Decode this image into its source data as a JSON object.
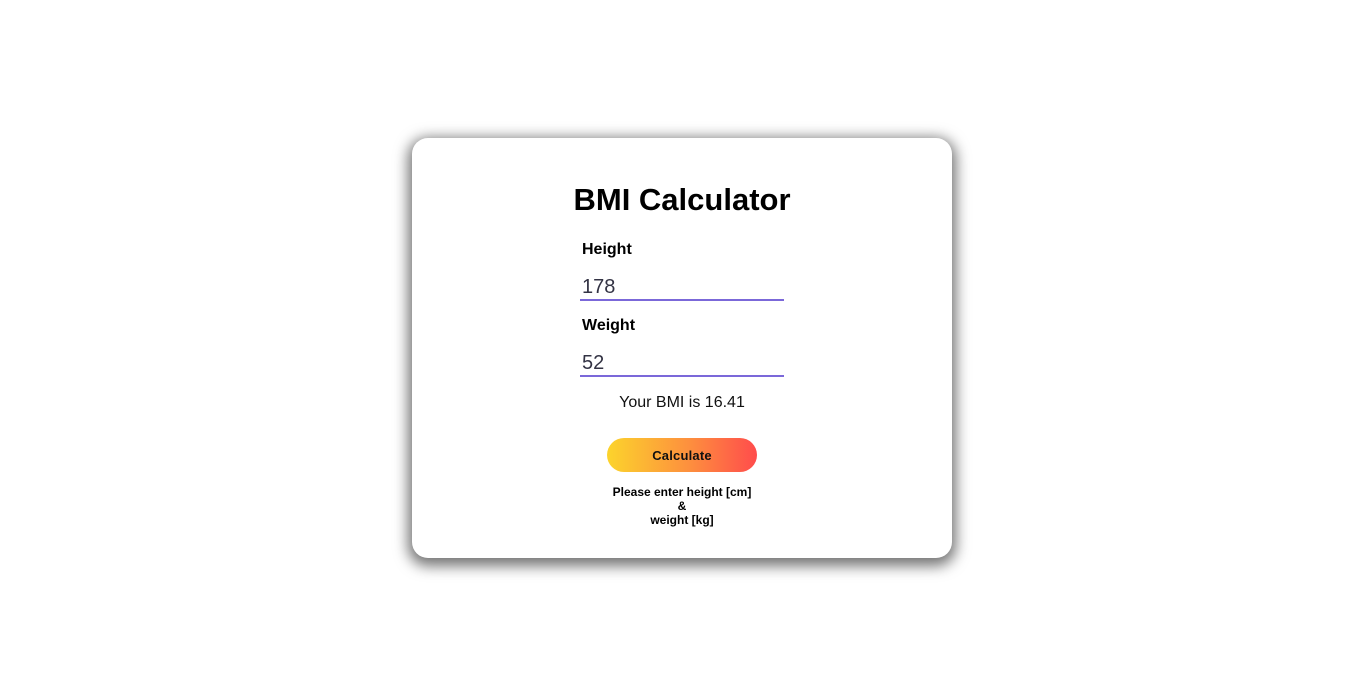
{
  "app": {
    "title": "BMI Calculator"
  },
  "form": {
    "height_label": "Height",
    "height_value": "178",
    "weight_label": "Weight",
    "weight_value": "52"
  },
  "result": {
    "text": "Your BMI is 16.41"
  },
  "actions": {
    "calculate_label": "Calculate"
  },
  "hint": {
    "line1": "Please enter height [cm]",
    "line2": "&",
    "line3": "weight [kg]"
  },
  "colors": {
    "input_underline": "#7b68d9",
    "button_gradient_start": "#fcd42c",
    "button_gradient_end": "#ff4c4c"
  }
}
